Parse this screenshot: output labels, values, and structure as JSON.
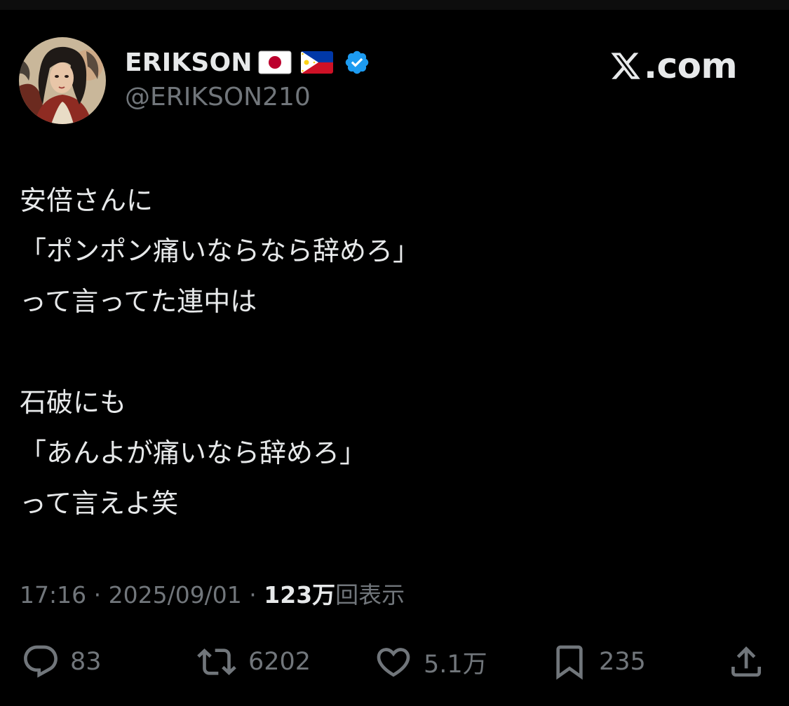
{
  "author": {
    "display_name": "ERIKSON",
    "handle": "@ERIKSON210",
    "flags": [
      "japan-flag-icon",
      "philippines-flag-icon"
    ],
    "verified_badge": "verified-badge-icon",
    "verified_color": "#1d9bf0"
  },
  "brand": {
    "text": ".com",
    "logo_icon": "x-logo-icon"
  },
  "tweet": {
    "lines": [
      "安倍さんに",
      "「ポンポン痛いならなら辞めろ」",
      "って言ってた連中は",
      "",
      "石破にも",
      "「あんよが痛いなら辞めろ」",
      "って言えよ笑"
    ]
  },
  "meta": {
    "time": "17:16",
    "separator": " · ",
    "date": "2025/09/01",
    "views_count": "123万",
    "views_label": "回表示"
  },
  "actions": {
    "replies": {
      "icon": "reply-icon",
      "count": "83"
    },
    "reposts": {
      "icon": "repost-icon",
      "count": "6202"
    },
    "likes": {
      "icon": "heart-icon",
      "count": "5.1万"
    },
    "bookmarks": {
      "icon": "bookmark-icon",
      "count": "235"
    },
    "share": {
      "icon": "share-icon"
    }
  },
  "colors": {
    "background": "#000000",
    "text": "#e7e9ea",
    "secondary_text": "#71767b",
    "accent": "#1d9bf0"
  }
}
